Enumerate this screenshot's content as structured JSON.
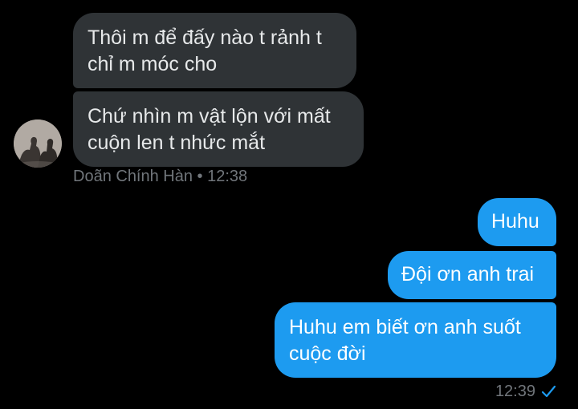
{
  "conversation": {
    "incoming_messages": [
      {
        "text": "Thôi m để đấy nào t rảnh t chỉ m móc cho"
      },
      {
        "text": "Chứ nhìn m vật lộn với mất cuộn len t nhức mắt"
      }
    ],
    "incoming_meta": {
      "sender": "Doãn Chính Hàn",
      "separator": "•",
      "time": "12:38"
    },
    "outgoing_messages": [
      {
        "text": "Huhu"
      },
      {
        "text": "Đội ơn anh trai"
      },
      {
        "text": "Huhu em biết ơn anh suốt cuộc đời"
      }
    ],
    "outgoing_meta": {
      "time": "12:39",
      "status_icon": "check-icon"
    }
  },
  "colors": {
    "background": "#000000",
    "incoming_bubble": "#2f3336",
    "outgoing_bubble": "#1d9bf0",
    "meta_text": "#71767b",
    "check": "#1d9bf0"
  }
}
